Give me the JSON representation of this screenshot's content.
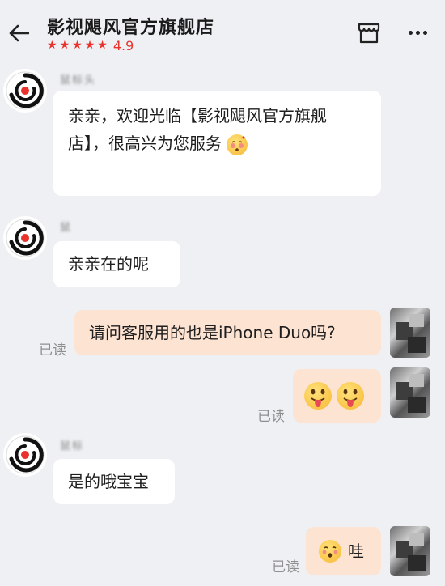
{
  "header": {
    "title": "影视飓风官方旗舰店",
    "rating": "4.9",
    "stars": 5
  },
  "messages": [
    {
      "sender": "鼠标头",
      "text_line1": "亲亲，欢迎光临【影视飓风官方旗舰",
      "text_line2": "店】，很高兴为您服务"
    },
    {
      "sender": "鼠",
      "text": "亲亲在的呢"
    },
    {
      "text": "请问客服用的也是iPhone Duo吗?",
      "status": "已读"
    },
    {
      "status": "已读"
    },
    {
      "sender": "鼠标",
      "text": "是的哦宝宝"
    },
    {
      "text": "哇",
      "status": "已读"
    }
  ],
  "colors": {
    "accent": "#e8322b",
    "outgoing_bubble": "#fde3d2",
    "incoming_bubble": "#ffffff",
    "background": "#eef0f3"
  }
}
